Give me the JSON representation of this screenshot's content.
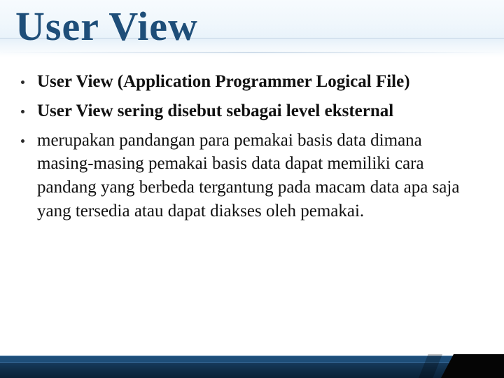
{
  "title": "User View",
  "bullets": [
    {
      "text": "User View (Application Programmer Logical File)",
      "bold": true
    },
    {
      "text": "User View sering disebut sebagai level eksternal",
      "bold": true
    },
    {
      "text": "merupakan pandangan para pemakai basis data dimana masing-masing pemakai basis data dapat memiliki cara pandang yang berbeda tergantung pada macam data apa saja yang tersedia atau dapat diakses oleh pemakai.",
      "bold": false
    }
  ],
  "colors": {
    "title": "#1e4e79",
    "footer_dark": "#0e2a44",
    "footer_mid": "#1e4e79"
  }
}
